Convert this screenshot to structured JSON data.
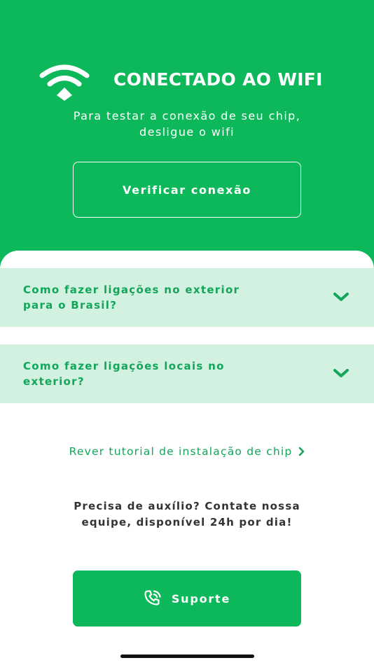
{
  "colors": {
    "brand_green": "#0db85a",
    "faq_background": "#d3f1e1",
    "accent_text": "#12a659",
    "body_text": "#333333"
  },
  "header": {
    "icon": "wifi-icon",
    "title": "CONECTADO AO WIFI",
    "subtitle_line1": "Para testar a conexão de seu chip,",
    "subtitle_line2": "desligue o wifi",
    "verify_button_label": "Verificar conexão"
  },
  "faq": {
    "items": [
      {
        "line1": "Como fazer ligações no exterior",
        "line2": "para o Brasil?",
        "icon": "chevron-down-icon"
      },
      {
        "line1": "Como fazer ligações locais no",
        "line2": "exterior?",
        "icon": "chevron-down-icon"
      }
    ]
  },
  "tutorial": {
    "label": "Rever tutorial de instalação de chip",
    "icon": "chevron-right-icon"
  },
  "help": {
    "line1": "Precisa de auxílio? Contate nossa",
    "line2": "equipe, disponível 24h por dia!"
  },
  "support": {
    "label": "Suporte",
    "icon": "phone-call-icon"
  }
}
